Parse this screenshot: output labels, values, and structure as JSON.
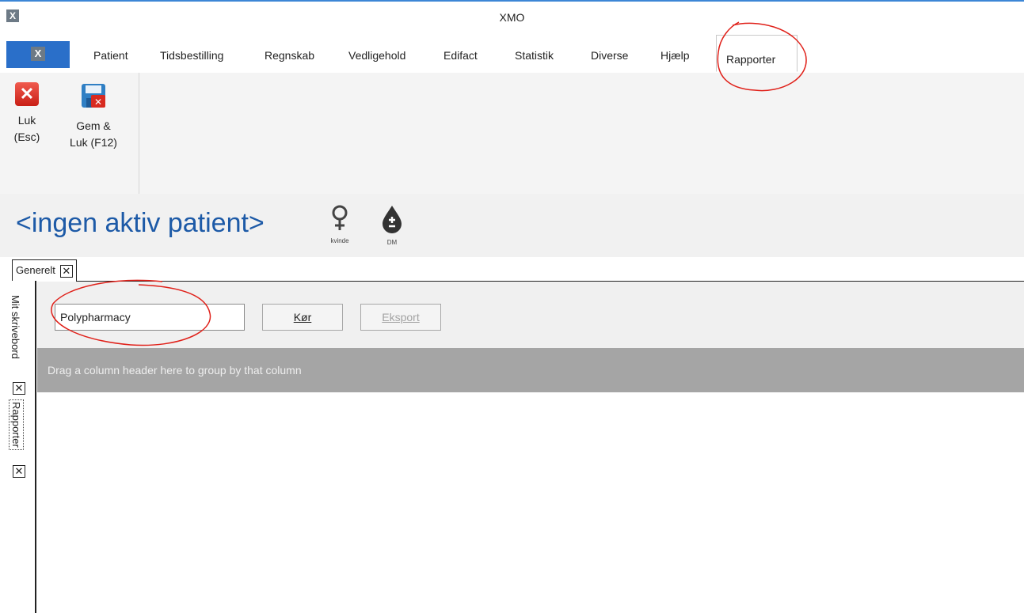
{
  "window": {
    "title": "XMO"
  },
  "ribbon": {
    "tabs": [
      "Patient",
      "Tidsbestilling",
      "Regnskab",
      "Vedligehold",
      "Edifact",
      "Statistik",
      "Diverse",
      "Hjælp",
      "Rapporter"
    ],
    "active_tab": "Rapporter",
    "buttons": {
      "close_label": "Luk\n(Esc)",
      "save_close_label": "Gem &\nLuk (F12)"
    }
  },
  "patient": {
    "name": "<ingen aktiv patient>",
    "gender_label": "kvinde",
    "dm_label": "DM"
  },
  "doc_tabs": {
    "general": "Generelt"
  },
  "side_tabs": [
    "Mit skrivebord",
    "Rapporter"
  ],
  "report": {
    "selected_report": "Polypharmacy",
    "run_button": "Kør",
    "export_button": "Eksport",
    "group_panel_text": "Drag a column header here to group by that column"
  }
}
